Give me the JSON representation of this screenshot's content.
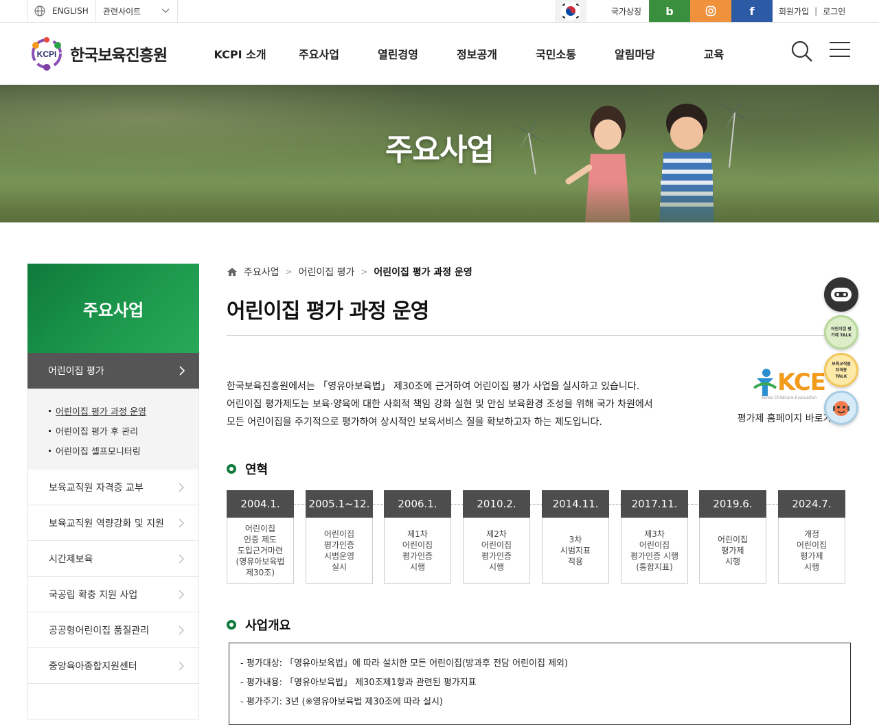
{
  "topbar": {
    "lang": "ENGLISH",
    "related": "관련사이트",
    "national_symbol": "국가상징",
    "sns": {
      "blog": "b",
      "facebook": "f"
    },
    "join": "회원가입",
    "separator": "|",
    "login": "로그인"
  },
  "header": {
    "logo_text": "한국보육진흥원",
    "logo_badge": "KCPI",
    "nav": [
      "KCPI 소개",
      "주요사업",
      "열린경영",
      "정보공개",
      "국민소통",
      "알림마당",
      "교육"
    ]
  },
  "hero": {
    "title": "주요사업"
  },
  "lnb": {
    "title": "주요사업",
    "active": "어린이집 평가",
    "sub": [
      "어린이집 평가 과정 운영",
      "어린이집 평가 후 관리",
      "어린이집 셀프모니터링"
    ],
    "items": [
      "보육교직원 자격증 교부",
      "보육교직원 역량강화 및 지원",
      "시간제보육",
      "국공립 확충 지원 사업",
      "공공형어린이집 품질관리",
      "중앙육아종합지원센터"
    ]
  },
  "content": {
    "breadcrumb": [
      "주요사업",
      "어린이집 평가",
      "어린이집 평가 과정 운영"
    ],
    "title": "어린이집 평가 과정 운영",
    "intro": [
      "한국보육진흥원에서는 「영유아보육법」 제30조에 근거하여 어린이집 평가 사업을 실시하고 있습니다.",
      "어린이집 평가제도는 보육·양육에 대한 사회적 책임 강화 실현 및 안심 보육환경 조성을 위해 국가 차원에서",
      "모든 어린이집을 주기적으로 평가하여 상시적인 보육서비스 질을 확보하고자 하는 제도입니다."
    ],
    "kce_logo": "KCE",
    "kce_sub": "Korea Childcare Evaluation",
    "kce_link": "평가제 홈페이지 바로가기",
    "history_title": "연혁",
    "history": [
      {
        "year": "2004.1.",
        "desc": "어린이집\n인증 제도\n도입근거마련\n(영유아보육법\n제30조)"
      },
      {
        "year": "2005.1~12.",
        "desc": "어린이집\n평가인증\n시범운영\n실시"
      },
      {
        "year": "2006.1.",
        "desc": "제1차\n어린이집\n평가인증\n시행"
      },
      {
        "year": "2010.2.",
        "desc": "제2차\n어린이집\n평가인증\n시행"
      },
      {
        "year": "2014.11.",
        "desc": "3차\n시범지표\n적용"
      },
      {
        "year": "2017.11.",
        "desc": "제3차\n어린이집\n평가인증 시행\n(통합지표)"
      },
      {
        "year": "2019.6.",
        "desc": "어린이집\n평가제\n시행"
      },
      {
        "year": "2024.7.",
        "desc": "개정\n어린이집\n평가제\n시행"
      }
    ],
    "overview_title": "사업개요",
    "overview": [
      "평가대상: 「영유아보육법」에 따라 설치한 모든 어린이집(방과후 전담 어린이집 제외)",
      "평가내용: 「영유아보육법」 제30조제1항과 관련된 평가지표",
      "평가주기: 3년 (※영유아보육법 제30조에 따라 실시)"
    ]
  },
  "quick": {
    "talk1": "어린이집 평가제 TALK",
    "talk2": "보육교직원 자격증 TALK"
  },
  "colors": {
    "brand_green": "#0f7a3c",
    "blog": "#3a8f3e",
    "insta": "#f0913c",
    "facebook": "#2c5aa5"
  }
}
